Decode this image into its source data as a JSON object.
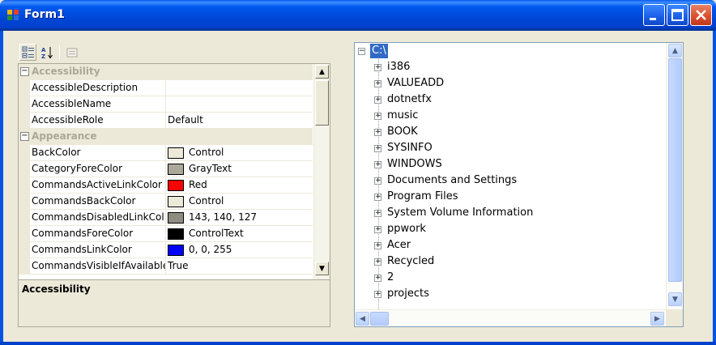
{
  "window": {
    "title": "Form1"
  },
  "property_grid": {
    "rows": [
      {
        "type": "category",
        "label": "Accessibility"
      },
      {
        "type": "property",
        "name": "AccessibleDescription",
        "value": ""
      },
      {
        "type": "property",
        "name": "AccessibleName",
        "value": ""
      },
      {
        "type": "property",
        "name": "AccessibleRole",
        "value": "Default"
      },
      {
        "type": "category",
        "label": "Appearance"
      },
      {
        "type": "property",
        "name": "BackColor",
        "value": "Control",
        "swatch": "#ece9d8"
      },
      {
        "type": "property",
        "name": "CategoryForeColor",
        "value": "GrayText",
        "swatch": "#aca899"
      },
      {
        "type": "property",
        "name": "CommandsActiveLinkColor",
        "value": "Red",
        "swatch": "#ff0000"
      },
      {
        "type": "property",
        "name": "CommandsBackColor",
        "value": "Control",
        "swatch": "#ece9d8"
      },
      {
        "type": "property",
        "name": "CommandsDisabledLinkCol",
        "value": "143, 140, 127",
        "swatch": "#8f8c7f"
      },
      {
        "type": "property",
        "name": "CommandsForeColor",
        "value": "ControlText",
        "swatch": "#000000"
      },
      {
        "type": "property",
        "name": "CommandsLinkColor",
        "value": "0, 0, 255",
        "swatch": "#0000ff"
      },
      {
        "type": "property",
        "name": "CommandsVisibleIfAvailable",
        "value": "True"
      }
    ],
    "description_title": "Accessibility"
  },
  "tree": {
    "root": "C:\\",
    "children": [
      "i386",
      "VALUEADD",
      "dotnetfx",
      "music",
      "BOOK",
      "SYSINFO",
      "WINDOWS",
      "Documents and Settings",
      "Program Files",
      "System Volume Information",
      "ppwork",
      "Acer",
      "Recycled",
      "2",
      "projects"
    ]
  },
  "colors": {
    "titlebar": "#0054e3",
    "selection": "#316ac5",
    "category_text": "#aca899"
  },
  "icons": {
    "app": "form-app-icon",
    "categorized": "categorized-view-icon",
    "alphabetical": "alphabetical-sort-icon",
    "property_pages": "property-pages-icon"
  }
}
